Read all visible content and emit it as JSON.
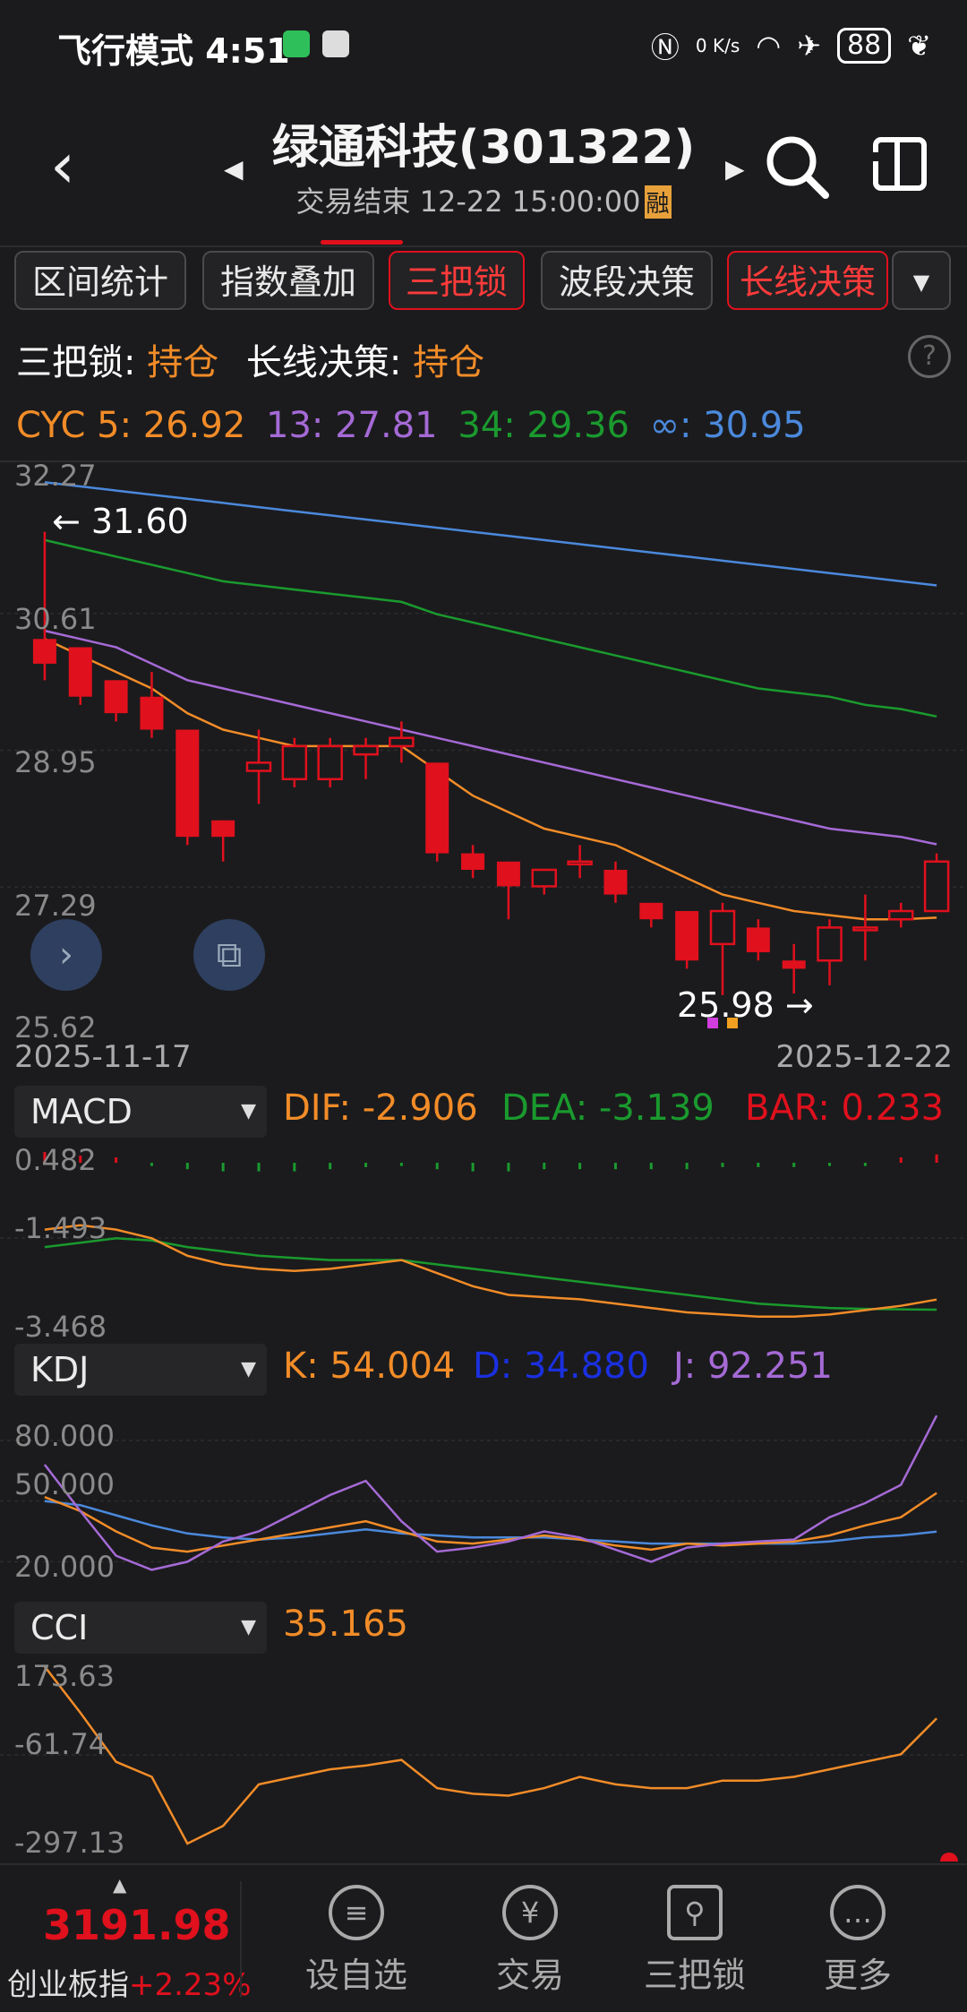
{
  "status_bar": {
    "left_text": "飞行模式 4:51",
    "network_speed": "0 K/s",
    "battery": "88",
    "icons": [
      "nfc-icon",
      "wifi-icon",
      "airplane-icon",
      "battery-icon",
      "leaf-icon"
    ]
  },
  "header": {
    "title": "绿通科技(301322)",
    "subtitle": "交易结束 12-22 15:00:00",
    "badge": "融"
  },
  "toolbar": {
    "buttons": [
      "区间统计",
      "指数叠加",
      "三把锁",
      "波段决策",
      "长线决策"
    ]
  },
  "signal": {
    "lock_label": "三把锁:",
    "lock_value": "持仓",
    "long_label": "长线决策:",
    "long_value": "持仓"
  },
  "cyc": {
    "l5": "CYC 5: 26.92",
    "l13": "13: 27.81",
    "l34": "34: 29.36",
    "linf": "∞: 30.95"
  },
  "colors": {
    "up": "#e0101d",
    "cyc5": "#f28c28",
    "cyc13": "#a56ad6",
    "cyc34": "#1a9a2e",
    "cycinf": "#4b89dc",
    "dea": "#1a9a2e",
    "kdj_d": "#1a30e0"
  },
  "main_chart": {
    "y_ticks": [
      "32.27",
      "30.61",
      "28.95",
      "27.29",
      "25.62"
    ],
    "high_label": "31.60",
    "low_label": "25.98",
    "date_start": "2025-11-17",
    "date_end": "2025-12-22"
  },
  "chart_data": [
    {
      "type": "candlestick",
      "ylim": [
        25.62,
        32.27
      ],
      "candles": [
        [
          30.3,
          30.0,
          31.6,
          29.8
        ],
        [
          30.2,
          29.6,
          30.2,
          29.5
        ],
        [
          29.8,
          29.4,
          29.8,
          29.3
        ],
        [
          29.6,
          29.2,
          29.9,
          29.1
        ],
        [
          29.2,
          27.9,
          29.2,
          27.8
        ],
        [
          28.1,
          27.9,
          28.1,
          27.6
        ],
        [
          28.7,
          28.8,
          29.2,
          28.3
        ],
        [
          28.6,
          29.0,
          29.1,
          28.5
        ],
        [
          28.6,
          29.0,
          29.1,
          28.5
        ],
        [
          28.9,
          29.0,
          29.1,
          28.6
        ],
        [
          29.0,
          29.1,
          29.3,
          28.8
        ],
        [
          28.8,
          27.7,
          28.8,
          27.6
        ],
        [
          27.7,
          27.5,
          27.8,
          27.4
        ],
        [
          27.6,
          27.3,
          27.6,
          26.9
        ],
        [
          27.3,
          27.5,
          27.5,
          27.2
        ],
        [
          27.6,
          27.6,
          27.8,
          27.4
        ],
        [
          27.5,
          27.2,
          27.6,
          27.1
        ],
        [
          27.1,
          26.9,
          27.1,
          26.8
        ],
        [
          27.0,
          26.4,
          27.0,
          26.3
        ],
        [
          26.6,
          27.0,
          27.1,
          25.98
        ],
        [
          26.8,
          26.5,
          26.9,
          26.4
        ],
        [
          26.4,
          26.3,
          26.6,
          26.0
        ],
        [
          26.4,
          26.8,
          26.9,
          26.1
        ],
        [
          26.8,
          26.8,
          27.2,
          26.4
        ],
        [
          26.9,
          27.0,
          27.1,
          26.8
        ],
        [
          27.0,
          27.6,
          27.7,
          27.0
        ]
      ],
      "series": [
        {
          "name": "CYC 5",
          "values": [
            30.3,
            30.1,
            29.9,
            29.7,
            29.4,
            29.2,
            29.1,
            29.0,
            29.0,
            29.0,
            29.0,
            28.7,
            28.4,
            28.2,
            28.0,
            27.9,
            27.8,
            27.6,
            27.4,
            27.2,
            27.1,
            27.0,
            26.95,
            26.9,
            26.9,
            26.92
          ]
        },
        {
          "name": "13",
          "values": [
            30.4,
            30.3,
            30.2,
            30.0,
            29.8,
            29.7,
            29.6,
            29.5,
            29.4,
            29.3,
            29.2,
            29.1,
            29.0,
            28.9,
            28.8,
            28.7,
            28.6,
            28.5,
            28.4,
            28.3,
            28.2,
            28.1,
            28.0,
            27.95,
            27.9,
            27.81
          ]
        },
        {
          "name": "34",
          "values": [
            31.5,
            31.4,
            31.3,
            31.2,
            31.1,
            31.0,
            30.95,
            30.9,
            30.85,
            30.8,
            30.75,
            30.6,
            30.5,
            30.4,
            30.3,
            30.2,
            30.1,
            30.0,
            29.9,
            29.8,
            29.7,
            29.65,
            29.6,
            29.5,
            29.45,
            29.36
          ]
        },
        {
          "name": "∞",
          "values": [
            32.2,
            32.15,
            32.1,
            32.05,
            32.0,
            31.95,
            31.9,
            31.85,
            31.8,
            31.75,
            31.7,
            31.65,
            31.6,
            31.55,
            31.5,
            31.45,
            31.4,
            31.35,
            31.3,
            31.25,
            31.2,
            31.15,
            31.1,
            31.05,
            31.0,
            30.95
          ]
        }
      ]
    },
    {
      "type": "line",
      "title": "MACD",
      "ylim": [
        -3.468,
        0.482
      ],
      "y_ticks": [
        "0.482",
        "-1.493",
        "-3.468"
      ],
      "series": [
        {
          "name": "DIF",
          "values": [
            -1.3,
            -1.2,
            -1.3,
            -1.5,
            -1.9,
            -2.1,
            -2.2,
            -2.25,
            -2.2,
            -2.1,
            -2.0,
            -2.3,
            -2.6,
            -2.8,
            -2.85,
            -2.9,
            -3.0,
            -3.1,
            -3.2,
            -3.25,
            -3.3,
            -3.3,
            -3.25,
            -3.15,
            -3.05,
            -2.906
          ]
        },
        {
          "name": "DEA",
          "values": [
            -1.7,
            -1.6,
            -1.5,
            -1.55,
            -1.7,
            -1.8,
            -1.9,
            -1.95,
            -2.0,
            -2.0,
            -2.0,
            -2.1,
            -2.2,
            -2.3,
            -2.4,
            -2.5,
            -2.6,
            -2.7,
            -2.8,
            -2.9,
            -3.0,
            -3.05,
            -3.1,
            -3.12,
            -3.13,
            -3.139
          ]
        },
        {
          "name": "BAR",
          "values": [
            0.3,
            0.2,
            0.1,
            -0.1,
            -0.3,
            -0.4,
            -0.4,
            -0.4,
            -0.3,
            -0.2,
            -0.1,
            -0.3,
            -0.4,
            -0.4,
            -0.3,
            -0.3,
            -0.3,
            -0.3,
            -0.3,
            -0.2,
            -0.2,
            -0.2,
            -0.1,
            -0.05,
            0.05,
            0.233
          ]
        }
      ]
    },
    {
      "type": "line",
      "title": "KDJ",
      "ylim": [
        10,
        95
      ],
      "y_ticks": [
        "80.000",
        "50.000",
        "20.000"
      ],
      "series": [
        {
          "name": "K",
          "values": [
            52,
            45,
            35,
            27,
            25,
            28,
            31,
            34,
            37,
            40,
            35,
            30,
            29,
            31,
            33,
            31,
            28,
            26,
            29,
            28,
            29,
            30,
            33,
            38,
            42,
            54.004
          ]
        },
        {
          "name": "D",
          "values": [
            50,
            48,
            43,
            38,
            34,
            32,
            31,
            32,
            34,
            36,
            34,
            33,
            32,
            32,
            32,
            31,
            30,
            29,
            29,
            29,
            29,
            29,
            30,
            32,
            33,
            34.88
          ]
        },
        {
          "name": "J",
          "values": [
            68,
            45,
            23,
            16,
            20,
            30,
            35,
            44,
            53,
            60,
            40,
            25,
            27,
            30,
            35,
            32,
            26,
            20,
            27,
            29,
            30,
            31,
            42,
            49,
            58,
            92.251
          ]
        }
      ]
    },
    {
      "type": "line",
      "title": "CCI",
      "ylim": [
        -297.13,
        173.63
      ],
      "y_ticks": [
        "173.63",
        "-61.74",
        "-297.13"
      ],
      "series": [
        {
          "name": "CCI",
          "values": [
            173,
            50,
            -80,
            -120,
            -320,
            -250,
            -140,
            -120,
            -100,
            -90,
            -75,
            -150,
            -165,
            -170,
            -150,
            -120,
            -140,
            -150,
            -150,
            -130,
            -130,
            -120,
            -100,
            -80,
            -60,
            35.165
          ]
        }
      ]
    }
  ],
  "macd": {
    "label": "MACD",
    "dif": "DIF: -2.906",
    "dea": "DEA: -3.139",
    "bar": "BAR: 0.233"
  },
  "kdj": {
    "label": "KDJ",
    "k": "K: 54.004",
    "d": "D: 34.880",
    "j": "J: 92.251"
  },
  "cci": {
    "label": "CCI",
    "value": "35.165"
  },
  "bottom": {
    "index_value": "3191.98",
    "index_name": "创业板指",
    "index_pct": "+2.23%",
    "nav": [
      "设自选",
      "交易",
      "三把锁",
      "更多"
    ]
  }
}
